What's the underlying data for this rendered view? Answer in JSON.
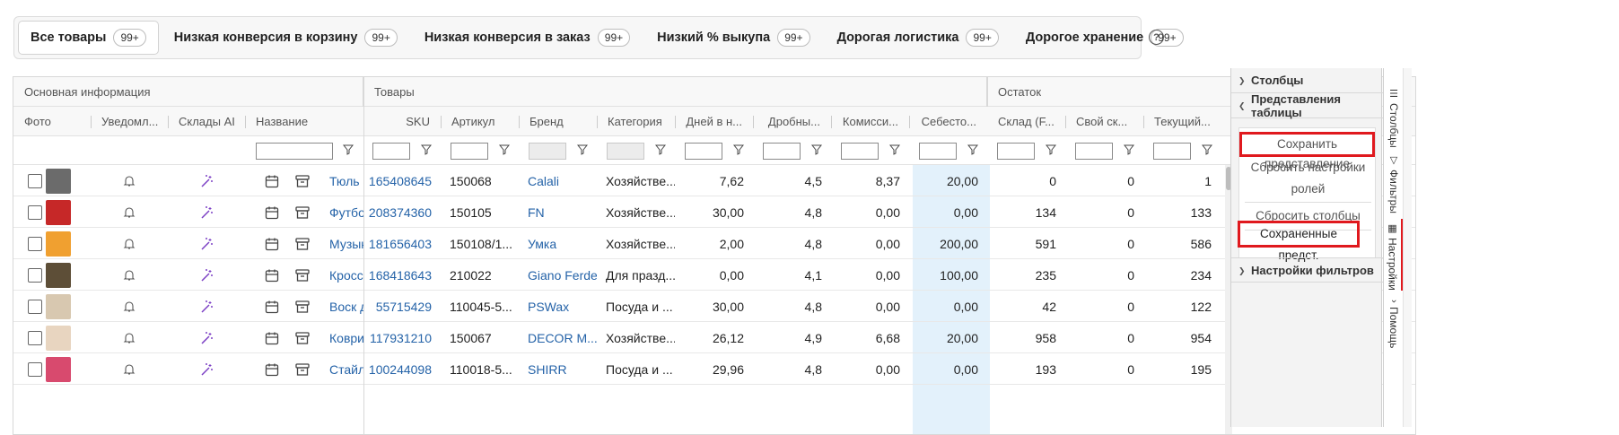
{
  "tabs": [
    {
      "label": "Все товары",
      "badge": "99+"
    },
    {
      "label": "Низкая конверсия в корзину",
      "badge": "99+"
    },
    {
      "label": "Низкая конверсия в заказ",
      "badge": "99+"
    },
    {
      "label": "Низкий % выкупа",
      "badge": "99+"
    },
    {
      "label": "Дорогая логистика",
      "badge": "99+"
    },
    {
      "label": "Дорогое хранение",
      "badge": "99+"
    }
  ],
  "help_glyph": "?",
  "groups": {
    "main": "Основная информация",
    "goods": "Товары",
    "stock": "Остаток"
  },
  "columns": {
    "photo": "Фото",
    "notify": "Уведомл...",
    "ai": "Склады AI",
    "name": "Название",
    "sku": "SKU",
    "article": "Артикул",
    "brand": "Бренд",
    "category": "Категория",
    "days": "Дней в н...",
    "fraction": "Дробны...",
    "commission": "Комисси...",
    "cost": "Себесто...",
    "warehouse": "Склад (F...",
    "own": "Свой ск...",
    "current": "Текущий..."
  },
  "rows": [
    {
      "name": "Тюль с",
      "sku": "165408645",
      "article": "150068",
      "brand": "Calali",
      "category": "Хозяйстве...",
      "days": "7,62",
      "fraction": "4,5",
      "commission": "8,37",
      "cost": "20,00",
      "warehouse": "0",
      "own": "0",
      "current": "1"
    },
    {
      "name": "Футбол",
      "sku": "208374360",
      "article": "150105",
      "brand": "FN",
      "category": "Хозяйстве...",
      "days": "30,00",
      "fraction": "4,8",
      "commission": "0,00",
      "cost": "0,00",
      "warehouse": "134",
      "own": "0",
      "current": "133"
    },
    {
      "name": "Музык",
      "sku": "181656403",
      "article": "150108/1...",
      "brand": "Умка",
      "category": "Хозяйстве...",
      "days": "2,00",
      "fraction": "4,8",
      "commission": "0,00",
      "cost": "200,00",
      "warehouse": "591",
      "own": "0",
      "current": "586"
    },
    {
      "name": "Кроссс",
      "sku": "168418643",
      "article": "210022",
      "brand": "Giano Ferde",
      "category": "Для празд...",
      "days": "0,00",
      "fraction": "4,1",
      "commission": "0,00",
      "cost": "100,00",
      "warehouse": "235",
      "own": "0",
      "current": "234"
    },
    {
      "name": "Воск д",
      "sku": "55715429",
      "article": "110045-5...",
      "brand": "PSWax",
      "category": "Посуда и ...",
      "days": "30,00",
      "fraction": "4,8",
      "commission": "0,00",
      "cost": "0,00",
      "warehouse": "42",
      "own": "0",
      "current": "122"
    },
    {
      "name": "Коври",
      "sku": "117931210",
      "article": "150067",
      "brand": "DECOR M...",
      "category": "Хозяйстве...",
      "days": "26,12",
      "fraction": "4,9",
      "commission": "6,68",
      "cost": "20,00",
      "warehouse": "958",
      "own": "0",
      "current": "954"
    },
    {
      "name": "Стайле",
      "sku": "100244098",
      "article": "110018-5...",
      "brand": "SHIRR",
      "category": "Посуда и ...",
      "days": "29,96",
      "fraction": "4,8",
      "commission": "0,00",
      "cost": "0,00",
      "warehouse": "193",
      "own": "0",
      "current": "195"
    }
  ],
  "panel": {
    "columns": "Столбцы",
    "views": "Представления таблицы",
    "save_view": "Сохранить представление",
    "reset_roles": "Сбросить настройки ролей",
    "reset_columns": "Сбросить столбцы",
    "saved_views": "Сохраненные предст.",
    "filter_settings": "Настройки фильтров"
  },
  "sidetabs": [
    "Столбцы",
    "Фильтры",
    "Настройки",
    "Помощь"
  ],
  "colors": {
    "accent_red": "#e0191e",
    "link_blue": "#2563a8",
    "cost_highlight": "#e3f1fb"
  }
}
